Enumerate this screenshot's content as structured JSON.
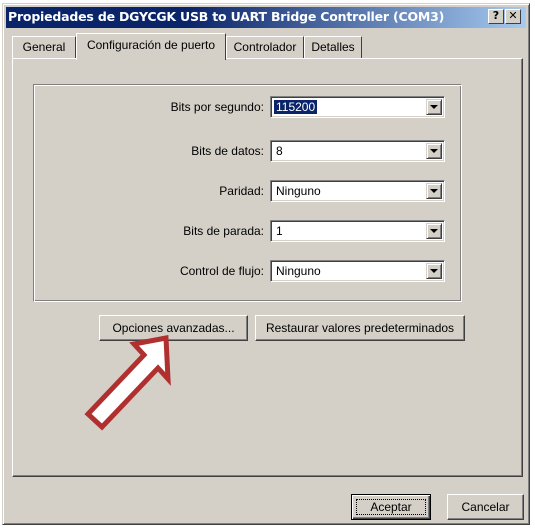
{
  "window": {
    "title": "Propiedades de DGYCGK USB to UART Bridge Controller (COM3)",
    "help_label": "?",
    "close_label": "✕"
  },
  "tabs": [
    {
      "label": "General"
    },
    {
      "label": "Configuración de puerto"
    },
    {
      "label": "Controlador"
    },
    {
      "label": "Detalles"
    }
  ],
  "active_tab": "Configuración de puerto",
  "settings": {
    "bits_por_segundo": {
      "label": "Bits por segundo:",
      "value": "115200"
    },
    "bits_de_datos": {
      "label": "Bits de datos:",
      "value": "8"
    },
    "paridad": {
      "label": "Paridad:",
      "value": "Ninguno"
    },
    "bits_de_parada": {
      "label": "Bits de parada:",
      "value": "1"
    },
    "control_de_flujo": {
      "label": "Control de flujo:",
      "value": "Ninguno"
    }
  },
  "buttons": {
    "advanced": "Opciones avanzadas...",
    "restore": "Restaurar valores predeterminados",
    "ok": "Aceptar",
    "cancel": "Cancelar"
  },
  "colors": {
    "title_bar": "#0a246a",
    "face": "#d4d0c8",
    "selection": "#0a246a",
    "annotation_arrow": "#b03030"
  },
  "icons": {
    "combo_arrow": "chevron-down-icon",
    "annotation": "arrow-pointer-icon"
  }
}
